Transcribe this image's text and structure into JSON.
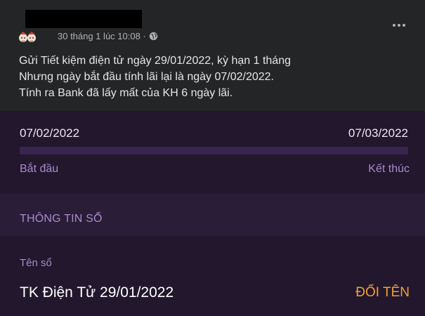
{
  "post": {
    "timestamp": "30 tháng 1 lúc 10:08 ·",
    "lines": [
      "Gửi Tiết kiệm điện tử ngày 29/01/2022, kỳ hạn 1 tháng",
      "Nhưng ngày bắt đầu tính lãi lại là ngày 07/02/2022.",
      "Tính ra Bank đã lấy mất của KH 6 ngày lãi."
    ],
    "icons": {
      "privacy": "globe-icon",
      "menu": "more-options-icon"
    }
  },
  "term": {
    "start_date": "07/02/2022",
    "end_date": "07/03/2022",
    "start_label": "Bắt đầu",
    "end_label": "Kết thúc",
    "progress": 0
  },
  "info": {
    "section_title": "THÔNG TIN SỔ",
    "field_label": "Tên sổ",
    "field_value": "TK Điện Tử 29/01/2022",
    "rename_label": "ĐỔI TÊN"
  },
  "colors": {
    "fb_surface": "#242526",
    "app_bg": "#22172c",
    "section_bg": "#2a1d37",
    "accent_purple": "#a98ad0",
    "accent_orange": "#f2a03a"
  }
}
